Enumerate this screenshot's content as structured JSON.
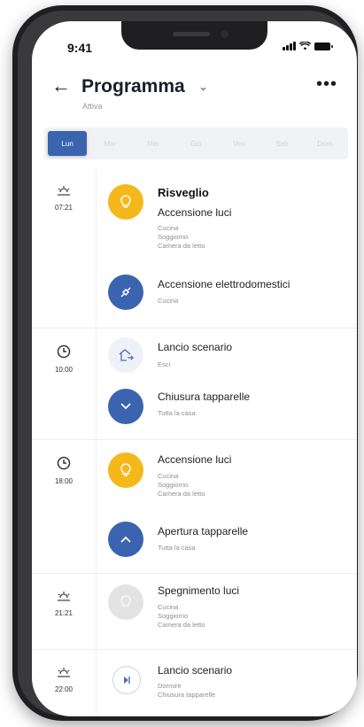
{
  "status_bar": {
    "time": "9:41"
  },
  "header": {
    "back_icon": "arrow-left-icon",
    "title": "Programma",
    "subtitle": "Attiva",
    "more_icon": "more-dots-icon"
  },
  "days": [
    "Lun",
    "Mar",
    "Mer",
    "Gio",
    "Ven",
    "Sab",
    "Dom"
  ],
  "active_day": "Lun",
  "schedule": [
    {
      "time": "07:21",
      "icon": "sunrise-icon",
      "entries": [
        {
          "name": "Risveglio",
          "action": "Accensione luci",
          "details": [
            "Cucina",
            "Soggiorno",
            "Camera da letto"
          ],
          "icon": "lightbulb-icon",
          "color": "#f4b81b"
        },
        {
          "name": "Accensione elettrodomestici",
          "details": [
            "Cucina"
          ],
          "icon": "plug-icon",
          "color": "#3a64b0"
        }
      ]
    },
    {
      "time": "10:00",
      "icon": "clock-icon",
      "entries": [
        {
          "name": "Lancio scenario",
          "details": [
            "Esci"
          ],
          "icon": "house-exit-icon",
          "color": "#eef1f8"
        },
        {
          "name": "Chiusura tapparelle",
          "details": [
            "Tutta la casa"
          ],
          "icon": "chevron-down-icon",
          "color": "#3a64b0"
        }
      ]
    },
    {
      "time": "18:00",
      "icon": "clock-icon",
      "entries": [
        {
          "name": "Accensione luci",
          "details": [
            "Cucina",
            "Soggiorno",
            "Camera da letto"
          ],
          "icon": "lightbulb-icon",
          "color": "#f4b81b"
        },
        {
          "name": "Apertura tapparelle",
          "details": [
            "Tutta la casa"
          ],
          "icon": "chevron-up-icon",
          "color": "#3a64b0"
        }
      ]
    },
    {
      "time": "21:21",
      "icon": "sunset-icon",
      "entries": [
        {
          "name": "Spegnimento luci",
          "details": [
            "Cucina",
            "Soggiorno",
            "Camera da letto"
          ],
          "icon": "lightbulb-off-icon",
          "color": "#e3e3e3"
        }
      ]
    },
    {
      "time": "22:00",
      "icon": "sunset-icon",
      "entries": [
        {
          "name": "Lancio scenario",
          "details": [
            "Dormire",
            "Chiusura tapparelle"
          ],
          "icon": "play-pause-icon",
          "color": "#ffffff"
        }
      ]
    }
  ]
}
